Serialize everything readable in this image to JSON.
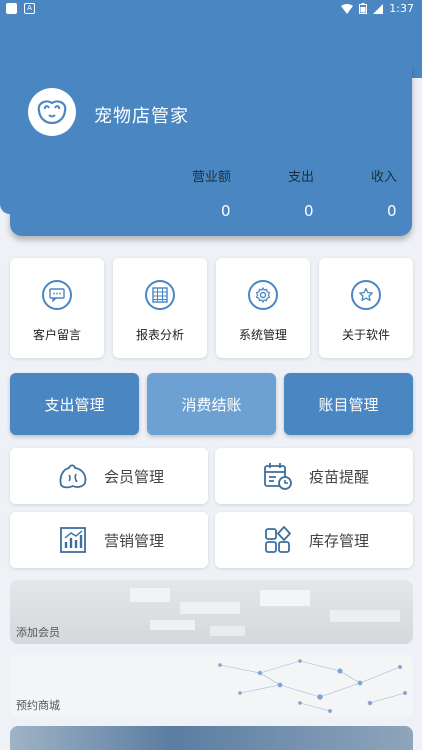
{
  "status_bar": {
    "time": "1:37",
    "notification_letter": "A"
  },
  "app": {
    "title": "宠物店管家"
  },
  "stats": [
    {
      "label": "营业额",
      "value": "0"
    },
    {
      "label": "支出",
      "value": "0"
    },
    {
      "label": "收入",
      "value": "0"
    }
  ],
  "quick_actions": [
    {
      "label": "客户留言",
      "icon": "message-icon"
    },
    {
      "label": "报表分析",
      "icon": "spreadsheet-icon"
    },
    {
      "label": "系统管理",
      "icon": "gear-icon"
    },
    {
      "label": "关于软件",
      "icon": "star-icon"
    }
  ],
  "primary_buttons": [
    {
      "label": "支出管理",
      "color": "#4a87c2"
    },
    {
      "label": "消费结账",
      "color": "#6ea1d3"
    },
    {
      "label": "账目管理",
      "color": "#4a87c2"
    }
  ],
  "menu": [
    {
      "label": "会员管理",
      "icon": "pet-icon"
    },
    {
      "label": "疫苗提醒",
      "icon": "calendar-clock-icon"
    },
    {
      "label": "营销管理",
      "icon": "bar-chart-icon"
    },
    {
      "label": "库存管理",
      "icon": "grid-diamond-icon"
    }
  ],
  "banners": [
    {
      "label": "添加会员"
    },
    {
      "label": "预约商城"
    }
  ],
  "colors": {
    "primary": "#4a87c2",
    "secondary": "#6ea1d3",
    "background": "#eef1f5"
  }
}
